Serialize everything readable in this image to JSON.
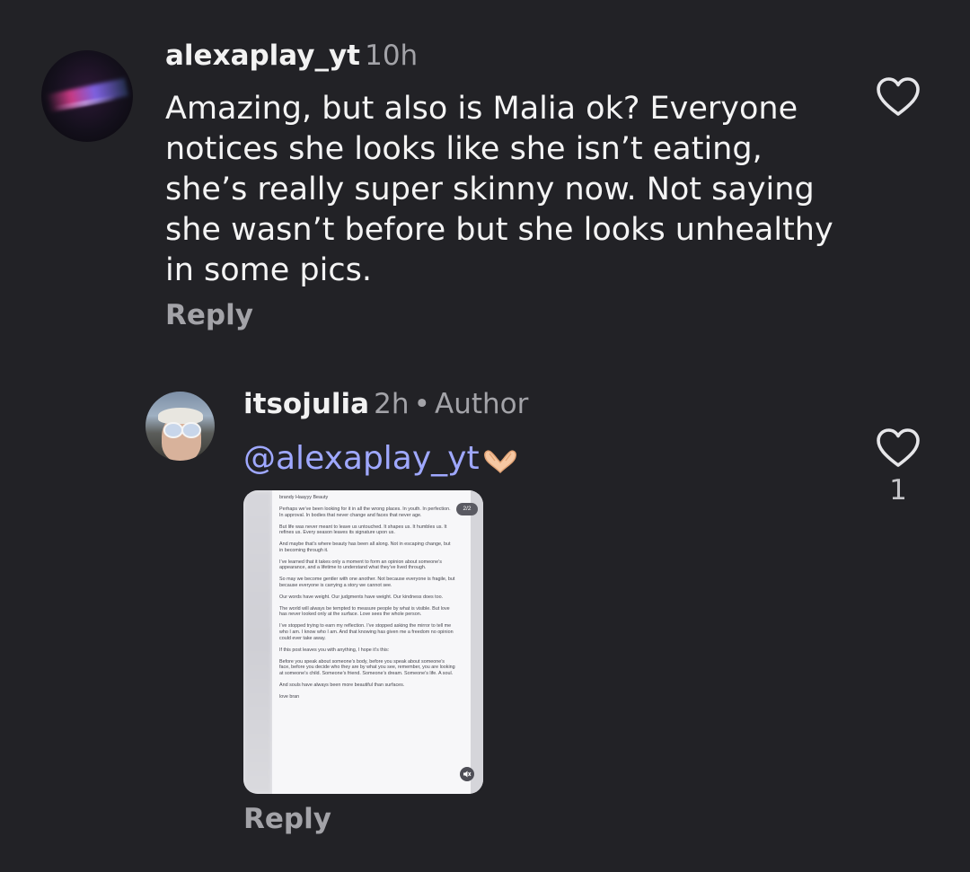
{
  "comments": [
    {
      "username": "alexaplay_yt",
      "time": "10h",
      "body": "Amazing, but also is Malia ok? Everyone notices she looks like she isn’t eating, she’s really super skinny now. Not saying she wasn’t before but she looks unhealthy in some pics.",
      "reply_label": "Reply"
    },
    {
      "username": "itsojulia",
      "time": "2h",
      "separator": "•",
      "author_badge": "Author",
      "mention": "@alexaplay_yt",
      "emoji": "heart-hands",
      "likes": "1",
      "reply_label": "Reply",
      "attachment": {
        "page_badge": "2/2",
        "header": "brandy Haayyy Beauty",
        "paragraphs": [
          "Perhaps we’ve been looking for it in all the wrong places. In youth. In perfection. In approval. In bodies that never change and faces that never age.",
          "But life was never meant to leave us untouched. It shapes us. It humbles us. It refines us. Every season leaves its signature upon us.",
          "And maybe that’s where beauty has been all along. Not in escaping change, but in becoming through it.",
          "I’ve learned that it takes only a moment to form an opinion about someone’s appearance, and a lifetime to understand what they’ve lived through.",
          "So may we become gentler with one another. Not because everyone is fragile, but because everyone is carrying a story we cannot see.",
          "Our words have weight. Our judgments have weight. Our kindness does too.",
          "The world will always be tempted to measure people by what is visible. But love has never looked only at the surface. Love sees the whole person.",
          "I’ve stopped trying to earn my reflection. I’ve stopped asking the mirror to tell me who I am. I know who I am. And that knowing has given me a freedom no opinion could ever take away.",
          "If this post leaves you with anything, I hope it’s this:",
          "Before you speak about someone’s body, before you speak about someone’s face, before you decide who they are by what you see, remember, you are looking at someone’s child. Someone’s friend. Someone’s dream. Someone’s life. A soul.",
          "And souls have always been more beautiful than surfaces.",
          "love bran"
        ]
      }
    }
  ],
  "colors": {
    "background": "#222226",
    "text": "#f2f2f2",
    "muted": "#a3a3a8",
    "mention": "#9fa8ff"
  }
}
